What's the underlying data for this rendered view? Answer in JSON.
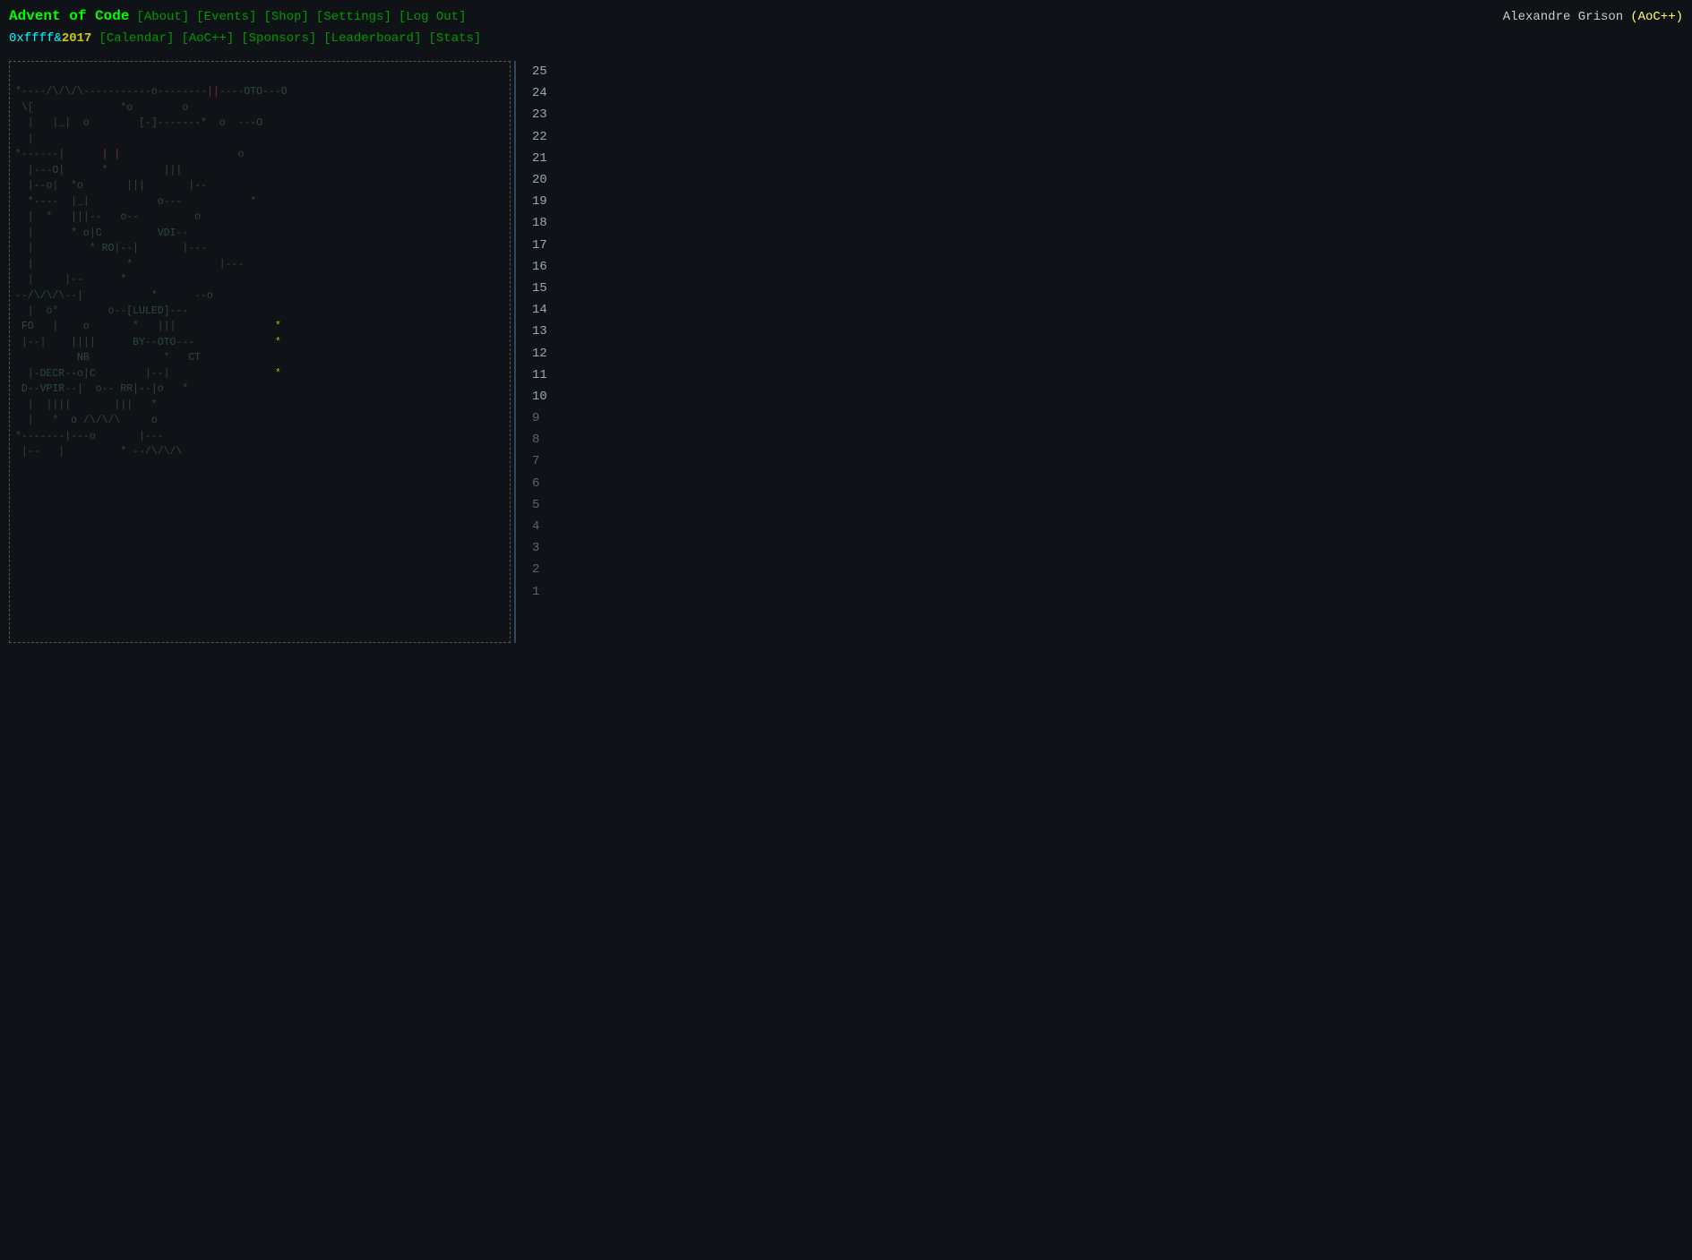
{
  "header": {
    "title": "Advent of Code",
    "hex_prefix": "0xffff&",
    "year": "2017",
    "nav_line1": [
      "[About]",
      "[Events]",
      "[Shop]",
      "[Settings]",
      "[Log Out]"
    ],
    "nav_line2": [
      "[Calendar]",
      "[AoC++]",
      "[Sponsors]",
      "[Leaderboard]",
      "[Stats]"
    ],
    "user_name": "Alexandre Grison",
    "user_badge": "(AoC++)"
  },
  "days": [
    25,
    24,
    23,
    22,
    21,
    20,
    19,
    18,
    17,
    16,
    15,
    14,
    13,
    12,
    11,
    10,
    9,
    8,
    7,
    6,
    5,
    4,
    3,
    2,
    1
  ]
}
